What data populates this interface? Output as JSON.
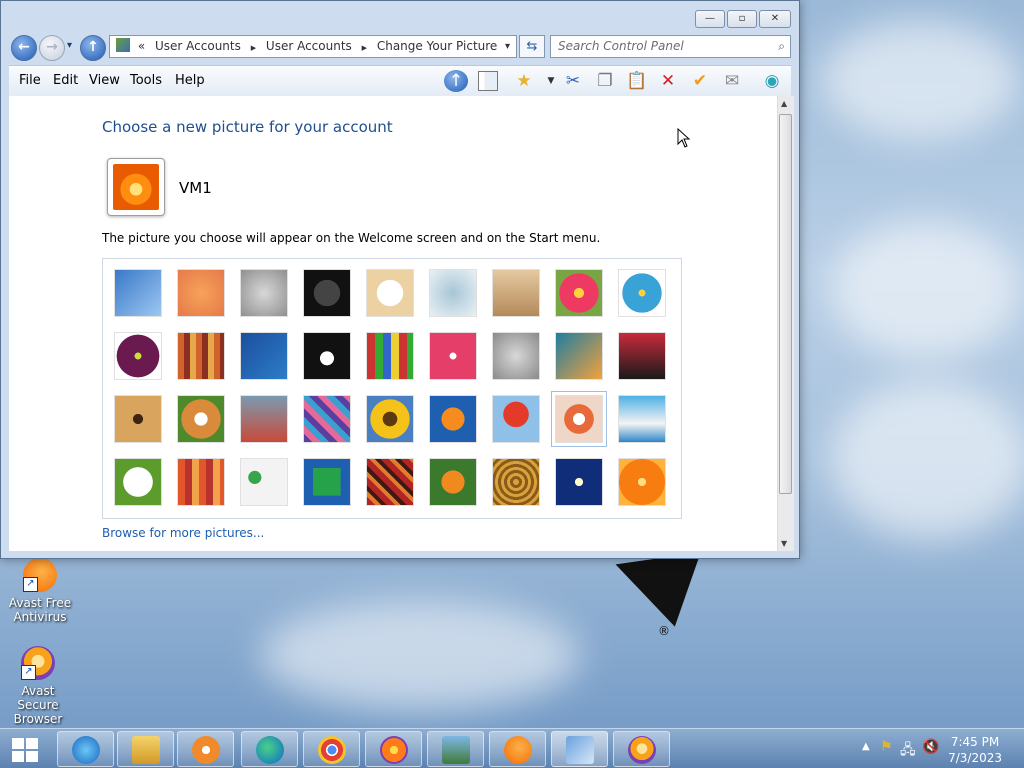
{
  "window": {
    "controls": {
      "minimize": "—",
      "maximize": "▫",
      "close": "✕"
    },
    "back_glyph": "←",
    "forward_glyph": "→",
    "up_glyph": "↑",
    "recent_glyph": "▾",
    "address": {
      "overflow": "«",
      "crumbs": [
        "User Accounts",
        "User Accounts",
        "Change Your Picture"
      ],
      "separator": "▶",
      "dropdown": "▾"
    },
    "refresh_glyph": "⇆",
    "search": {
      "placeholder": "Search Control Panel",
      "icon": "search-icon"
    }
  },
  "menu": {
    "items": [
      "File",
      "Edit",
      "View",
      "Tools",
      "Help"
    ]
  },
  "toolbar_icons": [
    "up-icon",
    "pane-icon",
    "favorites-icon",
    "cut-icon",
    "copy-icon",
    "paste-icon",
    "delete-icon",
    "checkmark-icon",
    "mail-icon",
    "shell-icon"
  ],
  "page": {
    "heading": "Choose a new picture for your account",
    "username": "VM1",
    "description": "The picture you choose will appear on the Welcome screen and on the Start menu.",
    "browse_link": "Browse for more pictures...",
    "pictures": [
      "roller-coaster",
      "starfish",
      "robot-figure",
      "record-player",
      "lucky-cat",
      "gyroscope",
      "kitten",
      "flower",
      "pinwheel",
      "ball",
      "fabric",
      "leaf",
      "dog",
      "crayons",
      "star-ornament",
      "jacks",
      "stairs",
      "paper-crane",
      "guitar",
      "puppy",
      "toy-robot",
      "scarves",
      "sunflower",
      "fish",
      "hot-air-balloon",
      "doll",
      "sailboat",
      "soccer-ball",
      "textile",
      "marbles",
      "window",
      "woven-pattern",
      "butterfly",
      "basket",
      "lantern",
      "orange-flower"
    ],
    "selected_index": 25
  },
  "desktop_icons": [
    {
      "label": "Avast Free Antivirus"
    },
    {
      "label": "Avast Secure Browser"
    }
  ],
  "taskbar": {
    "apps": [
      "internet-explorer",
      "file-explorer",
      "media-player",
      "edge",
      "chrome",
      "firefox",
      "photo-viewer",
      "avast",
      "control-panel",
      "avast-browser"
    ],
    "time": "7:45 PM",
    "date": "7/3/2023"
  },
  "desktop_mark": "®"
}
